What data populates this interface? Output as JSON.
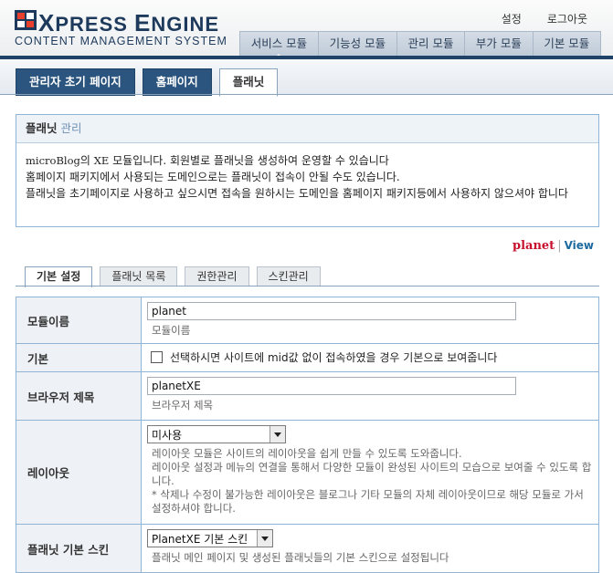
{
  "header": {
    "logo_title_first": "X",
    "logo_title_rest1": "PRESS ",
    "logo_title_e": "E",
    "logo_title_rest2": "NGINE",
    "logo_sub": "CONTENT MANAGEMENT SYSTEM",
    "top_links": [
      "설정",
      "로그아웃"
    ],
    "menu": [
      "서비스 모듈",
      "기능성 모듈",
      "관리 모듈",
      "부가 모듈",
      "기본 모듈"
    ]
  },
  "page_tabs": [
    "관리자 초기 페이지",
    "홈페이지",
    "플래닛"
  ],
  "panel": {
    "title": "플래닛",
    "title_sub": "관리",
    "line1_a": "microBlog",
    "line1_b": "의 ",
    "line1_c": "XE",
    "line1_d": " 모듈입니다. 회원별로 플래닛을 생성하여 운영할 수 있습니다",
    "line2": "홈페이지 패키지에서 사용되는 도메인으로는 플래닛이 접속이 안될 수도 있습니다.",
    "line3": "플래닛을 초기페이지로 사용하고 싶으시면 접속을 원하시는 도메인을 홈페이지 패키지등에서 사용하지 않으셔야 합니다"
  },
  "brand": {
    "name": "planet",
    "sep": "|",
    "view": "View"
  },
  "sub_tabs": [
    "기본 설정",
    "플래닛 목록",
    "권한관리",
    "스킨관리"
  ],
  "form": {
    "module_name": {
      "label": "모듈이름",
      "value": "planet",
      "desc": "모듈이름"
    },
    "default": {
      "label": "기본",
      "text": "선택하시면 사이트에 mid값 없이 접속하였을 경우 기본으로 보여줍니다"
    },
    "browser_title": {
      "label": "브라우저 제목",
      "value": "planetXE",
      "desc": "브라우저 제목"
    },
    "layout": {
      "label": "레이아웃",
      "selected": "미사용",
      "desc1": "레이아웃 모듈은 사이트의 레이아웃을 쉽게 만들 수 있도록 도와줍니다.",
      "desc2": "레이아웃 설정과 메뉴의 연결을 통해서 다양한 모듈이 완성된 사이트의 모습으로 보여줄 수 있도록 합니다.",
      "desc3": "* 삭제나 수정이 불가능한 레이아웃은 블로그나 기타 모듈의 자체 레이아웃이므로 해당 모듈로 가서 설정하셔야 합니다."
    },
    "skin": {
      "label": "플래닛 기본 스킨",
      "selected": "PlanetXE 기본 스킨",
      "desc": "플래닛 메인 페이지 및 생성된 플래닛들의 기본 스킨으로 설정됩니다"
    }
  },
  "colors": {
    "brand_red": "#c8102e",
    "nav_blue": "#2b557e",
    "border_blue": "#8fb4d6"
  }
}
